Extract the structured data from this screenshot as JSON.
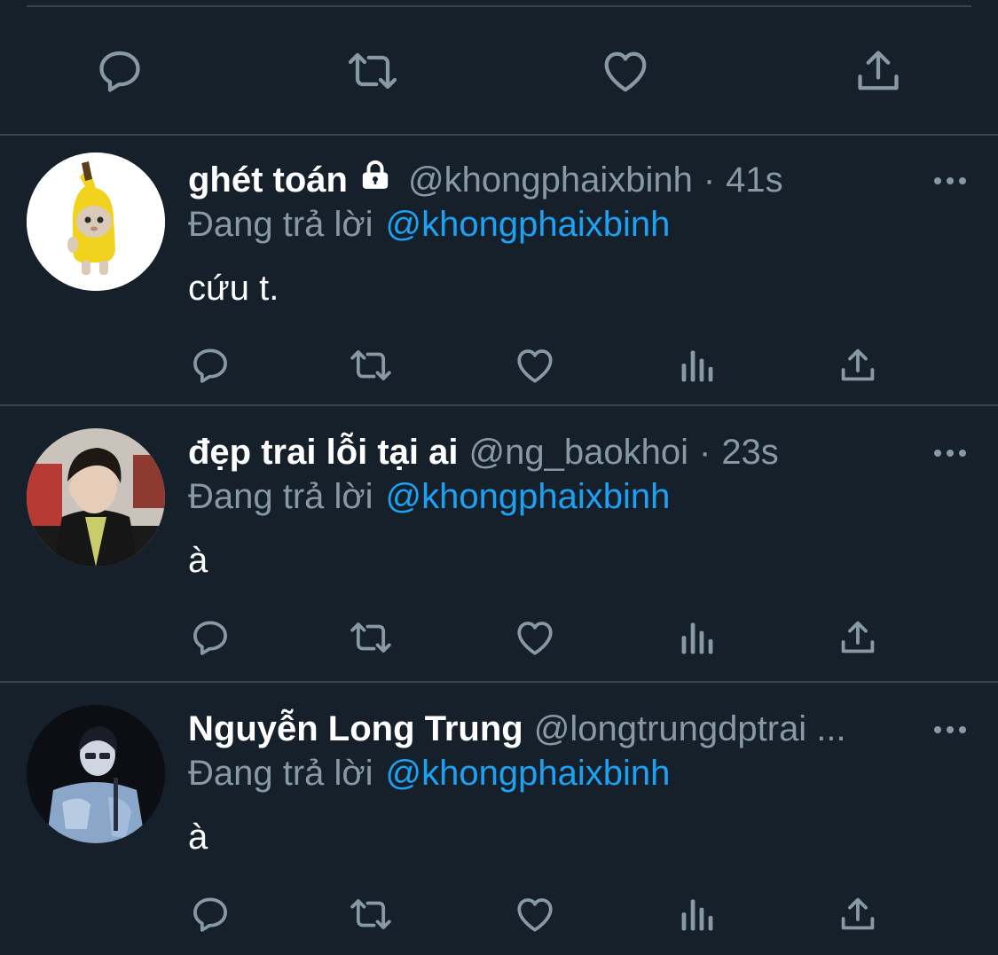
{
  "top_actions": {
    "icons": [
      "reply-icon",
      "retweet-icon",
      "like-icon",
      "share-icon"
    ]
  },
  "tweets": [
    {
      "display_name": "ghét toán",
      "protected": true,
      "handle": "@khongphaixbinh",
      "separator": "·",
      "time": "41s",
      "reply_prefix": "Đang trả lời",
      "reply_to": "@khongphaixbinh",
      "text": "cứu t."
    },
    {
      "display_name": "đẹp trai lỗi tại ai",
      "protected": false,
      "handle": "@ng_baokhoi",
      "separator": "·",
      "time": "23s",
      "reply_prefix": "Đang trả lời",
      "reply_to": "@khongphaixbinh",
      "text": "à"
    },
    {
      "display_name": "Nguyễn Long Trung",
      "protected": false,
      "handle": "@longtrungdptrai ...",
      "separator": "",
      "time": "",
      "reply_prefix": "Đang trả lời",
      "reply_to": "@khongphaixbinh",
      "text": "à"
    }
  ],
  "colors": {
    "background": "#15202b",
    "divider": "#38444d",
    "secondary_text": "#8899a6",
    "accent": "#1da1f2"
  }
}
